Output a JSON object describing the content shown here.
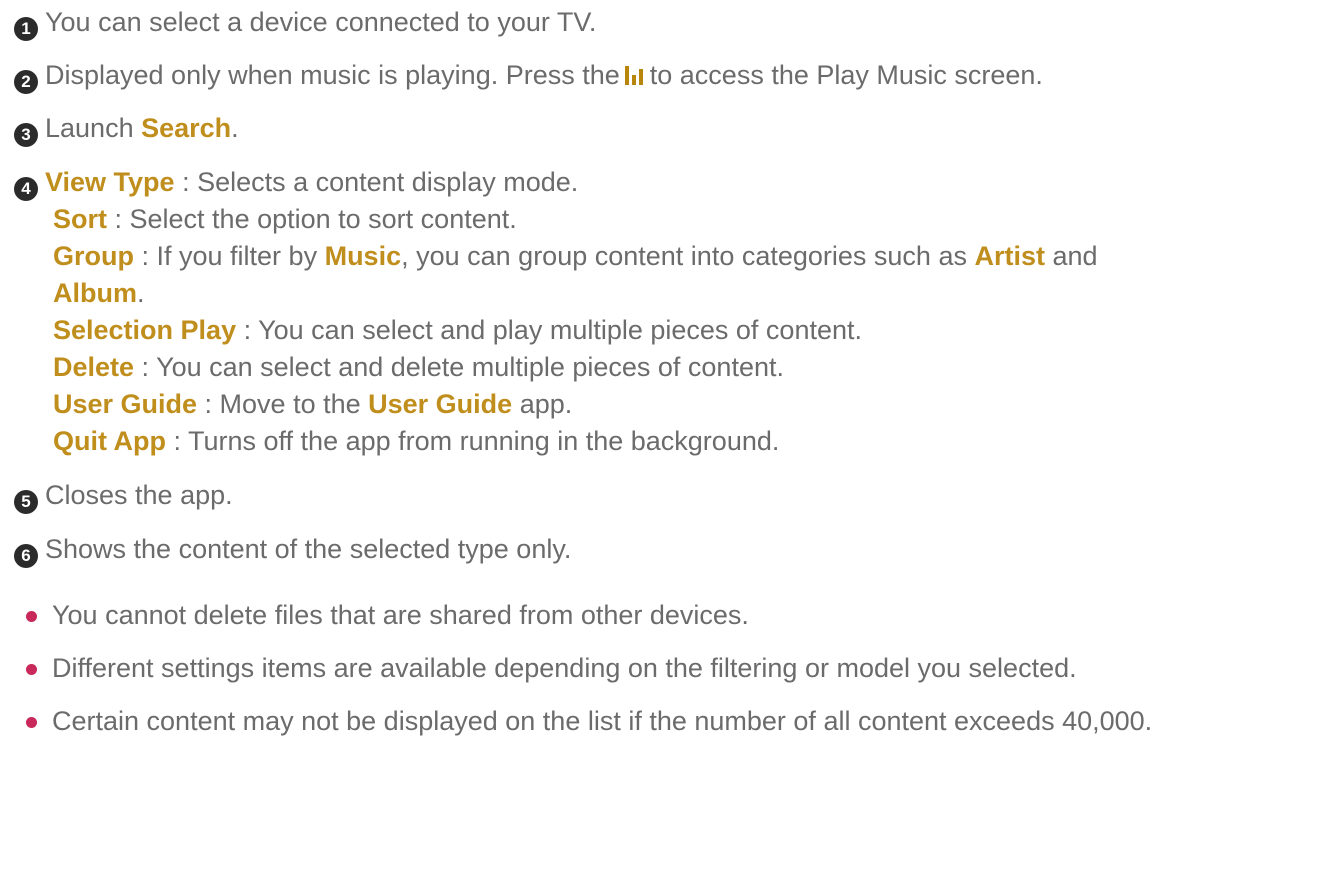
{
  "items": [
    {
      "num": "1",
      "text": "You can select a device connected to your TV."
    },
    {
      "num": "2",
      "text_before": "Displayed only when music is playing. Press the",
      "icon": "music-bars-icon",
      "text_after": "to access the Play Music screen."
    },
    {
      "num": "3",
      "prefix": "Launch ",
      "term": "Search",
      "suffix": "."
    },
    {
      "num": "4"
    },
    {
      "num": "5",
      "text": "Closes the app."
    },
    {
      "num": "6",
      "text": "Shows the content of the selected type only."
    }
  ],
  "options": {
    "view_type": {
      "term": "View Type",
      "desc": " : Selects a content display mode."
    },
    "sort": {
      "term": "Sort",
      "desc": " : Select the option to sort content."
    },
    "group": {
      "term": "Group",
      "desc1": " : If you filter by ",
      "music": "Music",
      "desc2": ", you can group content into categories such as ",
      "artist": "Artist",
      "and": " and",
      "album": "Album",
      "end": "."
    },
    "selection_play": {
      "term": "Selection Play",
      "desc": " : You can select and play multiple pieces of content."
    },
    "delete": {
      "term": "Delete",
      "desc": " : You can select and delete multiple pieces of content."
    },
    "user_guide": {
      "term": "User Guide",
      "desc1": " : Move to the ",
      "app_name": "User Guide",
      "desc2": " app."
    },
    "quit_app": {
      "term": "Quit App",
      "desc": " : Turns off the app from running in the background."
    }
  },
  "notes": [
    "You cannot delete files that are shared from other devices.",
    "Different settings items are available depending on the filtering or model you selected.",
    "Certain content may not be displayed on the list if the number of all content exceeds 40,000."
  ],
  "colors": {
    "highlight": "#c08e1c",
    "bullet": "#c8285a",
    "text": "#6b6b6b",
    "badge": "#2b2b2b"
  }
}
